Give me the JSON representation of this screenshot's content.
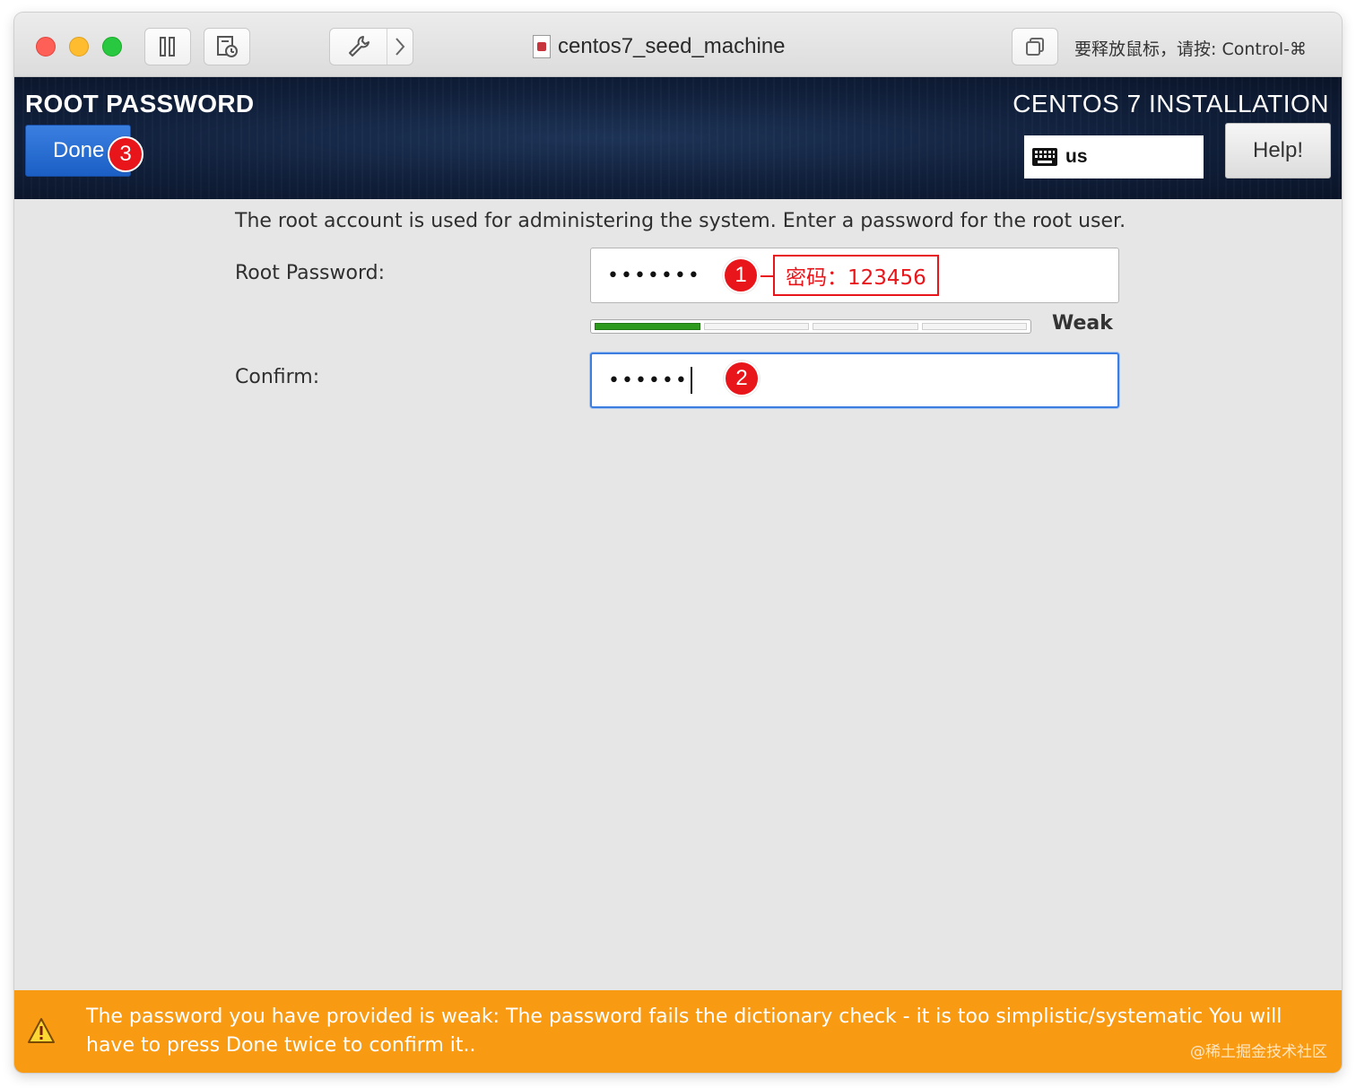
{
  "mac_window": {
    "title": "centos7_seed_machine",
    "release_hint": "要释放鼠标，请按: Control-⌘"
  },
  "header": {
    "spoke_title": "ROOT PASSWORD",
    "product_title": "CENTOS 7 INSTALLATION",
    "done_label": "Done",
    "keyboard_layout": "us",
    "help_label": "Help!"
  },
  "form": {
    "intro": "The root account is used for administering the system.  Enter a password for the root user.",
    "root_password_label": "Root Password:",
    "root_password_mask": "•••••••",
    "strength_label": "Weak",
    "strength_level": 0.25,
    "confirm_label": "Confirm:",
    "confirm_mask": "••••••"
  },
  "annotations": {
    "step1": "1",
    "step2": "2",
    "step3": "3",
    "password_note": "密码：123456",
    "accent": "#e8161b"
  },
  "warning": {
    "text": "The password you have provided is weak: The password fails the dictionary check - it is too simplistic/systematic You will have to press Done twice to confirm it..",
    "watermark": "@稀土掘金技术社区",
    "color": "#f99a13"
  }
}
